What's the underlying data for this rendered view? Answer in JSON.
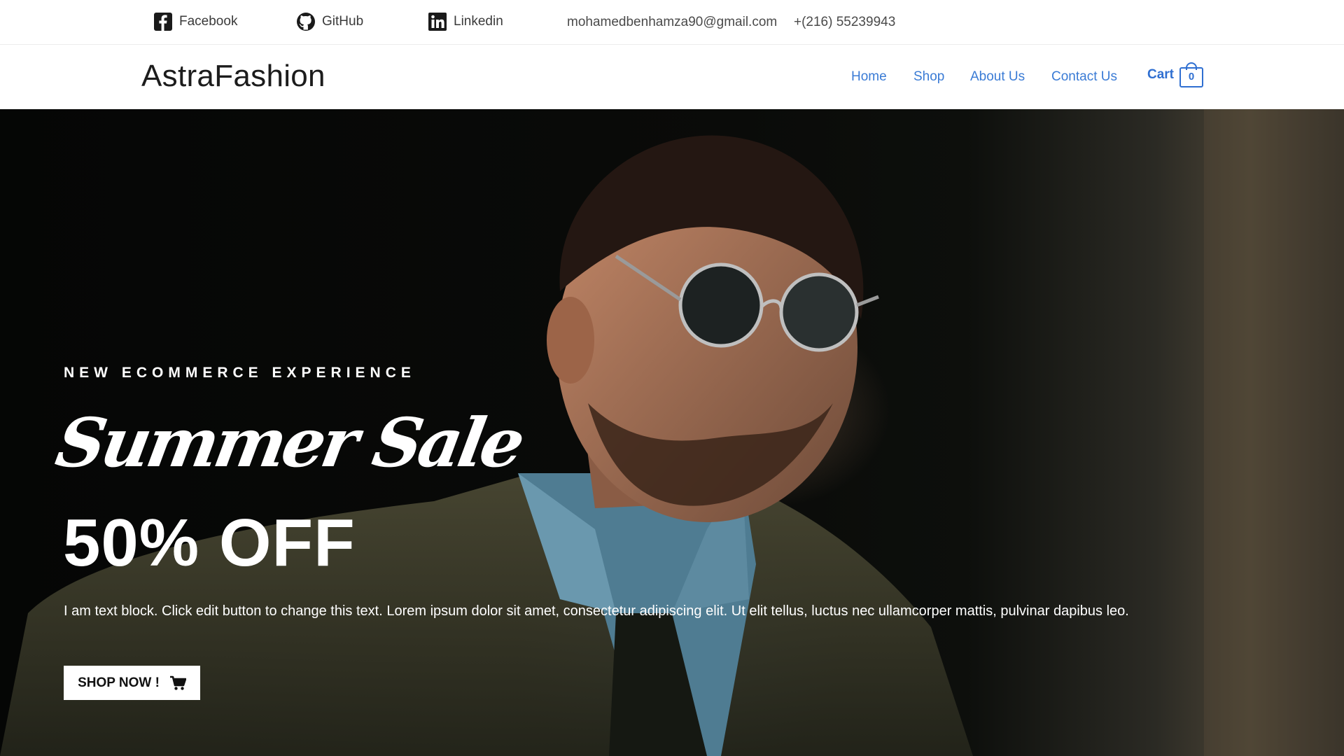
{
  "topbar": {
    "facebook_label": "Facebook",
    "github_label": "GitHub",
    "linkedin_label": "Linkedin",
    "email": "mohamedbenhamza90@gmail.com",
    "phone": "+(216) 55239943"
  },
  "header": {
    "logo": "AstraFashion",
    "nav": [
      "Home",
      "Shop",
      "About Us",
      "Contact Us"
    ],
    "cart_label": "Cart",
    "cart_count": "0"
  },
  "hero": {
    "kicker": "NEW ECOMMERCE EXPERIENCE",
    "script_title": "Summer Sale",
    "headline": "50% OFF",
    "description": "I am text block. Click edit button to change this text. Lorem ipsum dolor sit amet, consectetur adipiscing elit. Ut elit tellus, luctus nec ullamcorper mattis, pulvinar dapibus leo.",
    "cta_label": "SHOP NOW !"
  },
  "colors": {
    "nav_link": "#3a7bd5",
    "cart_accent": "#2f6fd1",
    "hero_text": "#ffffff"
  },
  "icons": [
    "facebook-icon",
    "github-icon",
    "linkedin-icon",
    "shopping-bag-icon",
    "cart-icon"
  ]
}
